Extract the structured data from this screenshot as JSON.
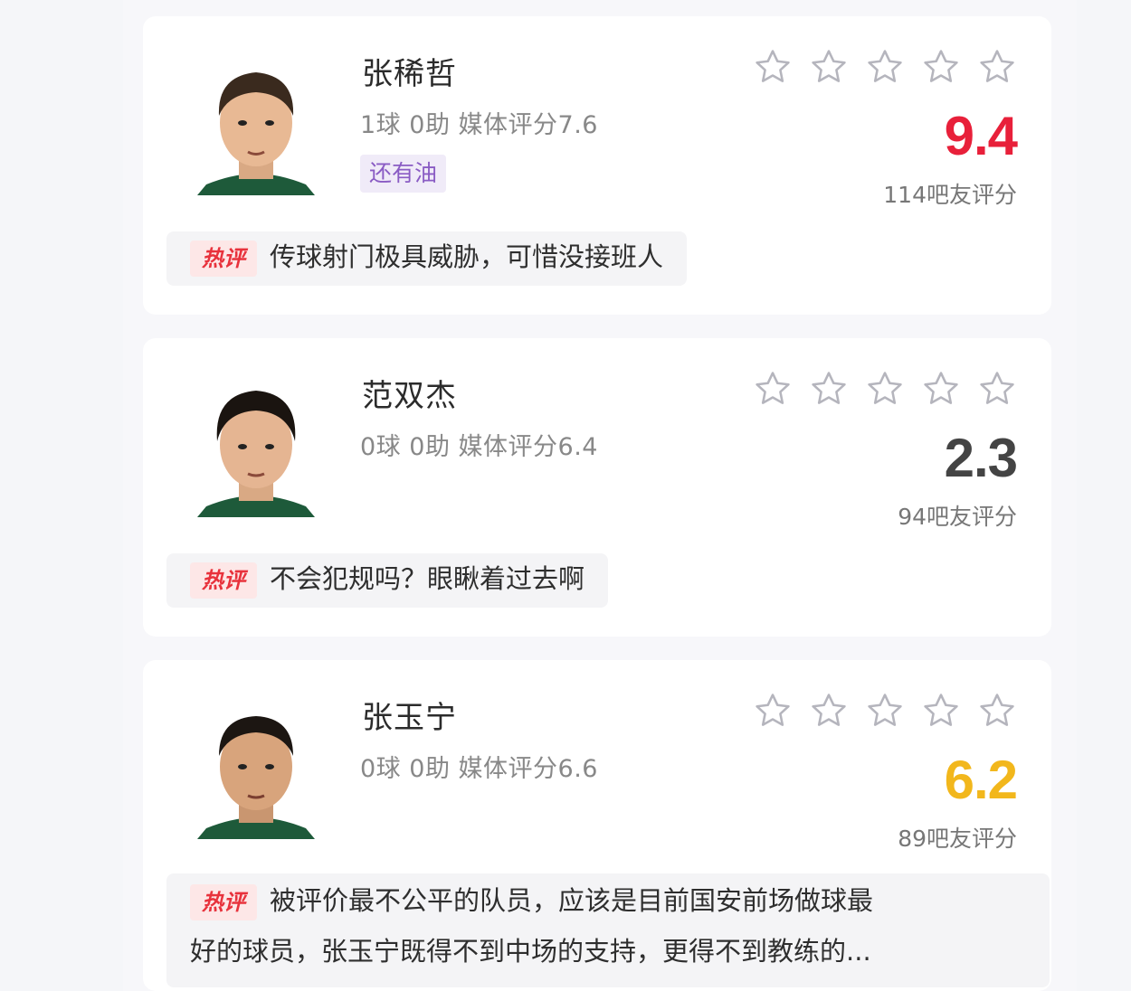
{
  "accent": {
    "score_high": "#e8203a",
    "score_low": "#444444",
    "score_mid": "#f2b71c",
    "tag": "#8a5cc4",
    "hot": "#e8323c"
  },
  "hot_label": "热评",
  "star_icon": "star-outline-icon",
  "players": [
    {
      "name": "张稀哲",
      "stats": "1球 0助  媒体评分7.6",
      "tag": "还有油",
      "score": "9.4",
      "score_color": "#e8203a",
      "raters": "114吧友评分",
      "comment": "传球射门极具威胁，可惜没接班人",
      "stars_total": 5
    },
    {
      "name": "范双杰",
      "stats": "0球 0助  媒体评分6.4",
      "tag": null,
      "score": "2.3",
      "score_color": "#444444",
      "raters": "94吧友评分",
      "comment": "不会犯规吗？眼瞅着过去啊",
      "stars_total": 5
    },
    {
      "name": "张玉宁",
      "stats": "0球 0助  媒体评分6.6",
      "tag": null,
      "score": "6.2",
      "score_color": "#f2b71c",
      "raters": "89吧友评分",
      "comment_line1": "被评价最不公平的队员，应该是目前国安前场做球最",
      "comment_line2": "好的球员，张玉宁既得不到中场的支持，更得不到教练的...",
      "stars_total": 5
    }
  ]
}
